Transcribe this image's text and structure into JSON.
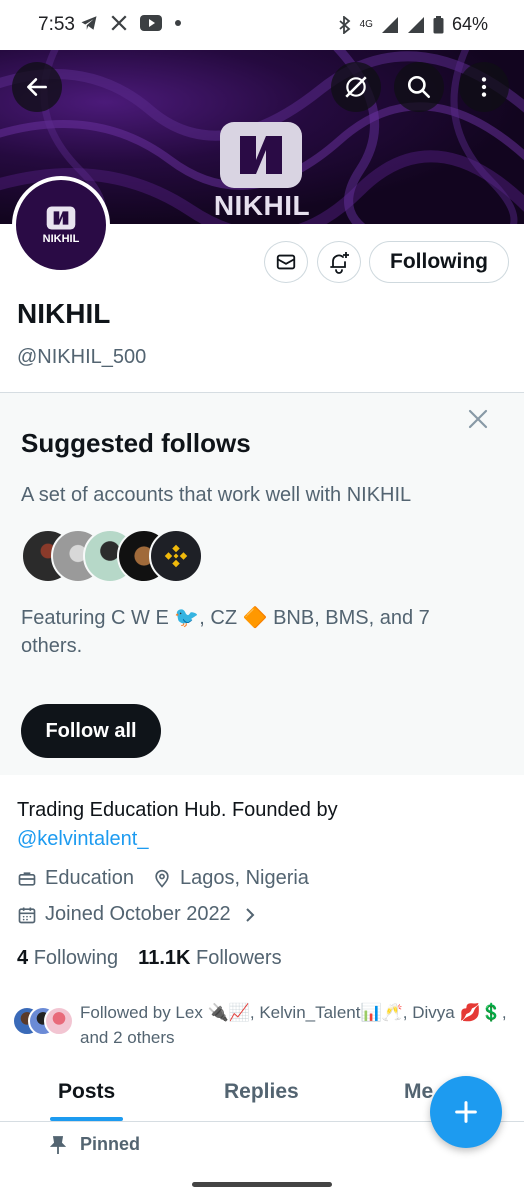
{
  "status_bar": {
    "time": "7:53",
    "network": "4G",
    "battery": "64%",
    "icons": [
      "telegram-icon",
      "x-icon",
      "youtube-icon",
      "dot-icon",
      "bluetooth-icon",
      "signal-icon",
      "wifi-icon",
      "battery-icon"
    ]
  },
  "header": {
    "banner_text": "NIKHIL",
    "back_icon": "arrow-left-icon",
    "action_icons": [
      "grok-icon",
      "search-icon",
      "more-vertical-icon"
    ]
  },
  "profile": {
    "avatar_text": "NIKHIL",
    "display_name": "NIKHIL",
    "handle": "@NIKHIL_500",
    "following_button": "Following",
    "bio_prefix": "Trading Education Hub.  Founded by",
    "bio_link": "@kelvintalent_",
    "category": "Education",
    "location": "Lagos, Nigeria",
    "joined": "Joined October 2022",
    "following_count": "4",
    "following_label": "Following",
    "followers_count": "11.1K",
    "followers_label": "Followers"
  },
  "suggested": {
    "title": "Suggested follows",
    "subtitle": "A set of accounts that work well with NIKHIL",
    "featuring": "Featuring C W E 🐦, CZ 🔶 BNB, BMS, and 7 others.",
    "follow_all": "Follow all"
  },
  "followed_by": {
    "text": "Followed by Lex 🔌📈, Kelvin_Talent📊🥂, Divya 💋💲, and 2 others"
  },
  "tabs": {
    "items": [
      "Posts",
      "Replies",
      "Me"
    ],
    "active": "Posts"
  },
  "pinned": {
    "label": "Pinned"
  },
  "colors": {
    "accent": "#1d9bf0",
    "text_primary": "#0f1419",
    "text_secondary": "#536471",
    "banner": "#2a0b45"
  }
}
